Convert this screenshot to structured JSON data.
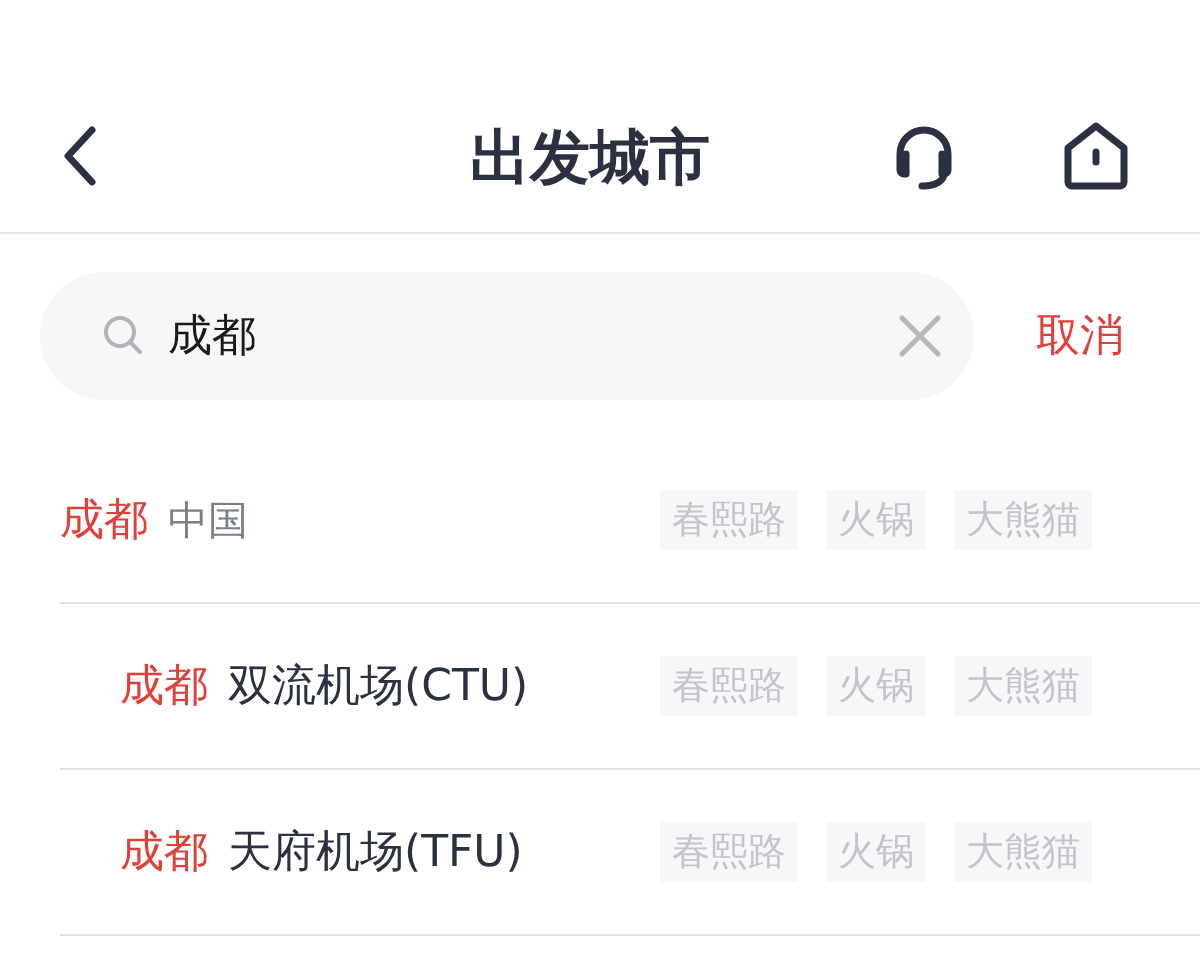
{
  "header": {
    "title": "出发城市"
  },
  "search": {
    "value": "成都"
  },
  "cancel": "取消",
  "results": [
    {
      "kind": "city",
      "match": "成都",
      "name": "中国",
      "tags": [
        "春熙路",
        "火锅",
        "大熊猫"
      ]
    },
    {
      "kind": "airport",
      "match": "成都",
      "name": "双流机场(CTU)",
      "tags": [
        "春熙路",
        "火锅",
        "大熊猫"
      ]
    },
    {
      "kind": "airport",
      "match": "成都",
      "name": "天府机场(TFU)",
      "tags": [
        "春熙路",
        "火锅",
        "大熊猫"
      ]
    }
  ]
}
